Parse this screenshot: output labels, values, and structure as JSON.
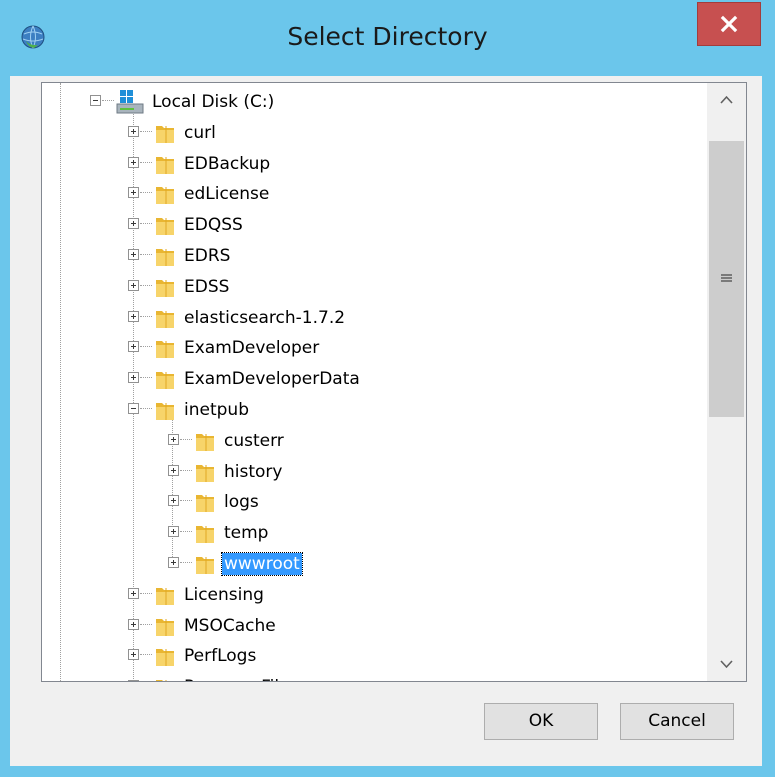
{
  "window": {
    "title": "Select Directory",
    "close_glyph": "x",
    "app_icon": "globe-icon"
  },
  "tree": {
    "drive": {
      "label": "Local Disk (C:)",
      "icon": "drive-icon",
      "expanded": true
    },
    "items": [
      {
        "label": "curl",
        "level": 1,
        "expander": "plus"
      },
      {
        "label": "EDBackup",
        "level": 1,
        "expander": "plus"
      },
      {
        "label": "edLicense",
        "level": 1,
        "expander": "plus"
      },
      {
        "label": "EDQSS",
        "level": 1,
        "expander": "plus"
      },
      {
        "label": "EDRS",
        "level": 1,
        "expander": "plus"
      },
      {
        "label": "EDSS",
        "level": 1,
        "expander": "plus"
      },
      {
        "label": "elasticsearch-1.7.2",
        "level": 1,
        "expander": "plus"
      },
      {
        "label": "ExamDeveloper",
        "level": 1,
        "expander": "plus"
      },
      {
        "label": "ExamDeveloperData",
        "level": 1,
        "expander": "plus"
      },
      {
        "label": "inetpub",
        "level": 1,
        "expander": "minus"
      },
      {
        "label": "custerr",
        "level": 2,
        "expander": "plus"
      },
      {
        "label": "history",
        "level": 2,
        "expander": "plus"
      },
      {
        "label": "logs",
        "level": 2,
        "expander": "plus"
      },
      {
        "label": "temp",
        "level": 2,
        "expander": "plus"
      },
      {
        "label": "wwwroot",
        "level": 2,
        "expander": "plus",
        "selected": true
      },
      {
        "label": "Licensing",
        "level": 1,
        "expander": "plus"
      },
      {
        "label": "MSOCache",
        "level": 1,
        "expander": "plus"
      },
      {
        "label": "PerfLogs",
        "level": 1,
        "expander": "plus"
      },
      {
        "label": "Program Files",
        "level": 1,
        "expander": "plus"
      }
    ]
  },
  "scrollbar": {
    "up_glyph": "^",
    "down_glyph": "v"
  },
  "buttons": {
    "ok": "OK",
    "cancel": "Cancel"
  },
  "colors": {
    "titlebar": "#6bc6eb",
    "close": "#c75050",
    "selection": "#3399ff",
    "folder": "#f3c84b"
  }
}
